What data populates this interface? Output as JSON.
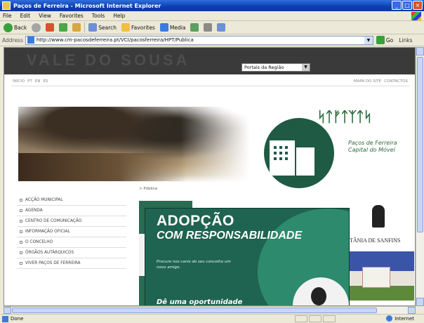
{
  "window": {
    "title": "Paços de Ferreira - Microsoft Internet Explorer",
    "controls": [
      "_",
      "□",
      "×"
    ]
  },
  "menu": [
    "File",
    "Edit",
    "View",
    "Favorites",
    "Tools",
    "Help"
  ],
  "toolbar": {
    "back": "Back",
    "search": "Search",
    "favorites": "Favorites",
    "media": "Media"
  },
  "address": {
    "label": "Address",
    "url": "http://www.cm-pacosdeferreira.pt/VCI/pacosferreira/HPT/Publica",
    "go": "Go",
    "links": "Links"
  },
  "site": {
    "logo": "VALE DO SOUSA",
    "portal_select": "Portais da Região",
    "topnav_left": [
      "INÍCIO",
      "PT",
      "EN",
      "ES"
    ],
    "topnav_right": [
      "MAPA DO SITE",
      "CONTACTOS"
    ],
    "emblem_wordmark": "ᛋᛏᚠᛏᛉᛏᛋ",
    "tagline": [
      "Paços de Ferreira",
      "Capital do Móvel"
    ],
    "breadcrumb": "> Pública",
    "leftnav": [
      "ACÇÃO MUNICIPAL",
      "AGENDA",
      "CENTRO DE COMUNICAÇÃO",
      "INFORMAÇÃO OFICIAL",
      "O CONCELHO",
      "ÓRGÃOS AUTÁRQUICOS",
      "VIVER PAÇOS DE FERREIRA"
    ],
    "sanfins_title": "CITÂNIA DE SANFINS"
  },
  "popup": {
    "title1": "ADOPÇÃO",
    "title2": "COM RESPONSABILIDADE",
    "body": "Procure nos canis do seu concelho um novo amigo.",
    "bottom": "Dê uma oportunidade"
  },
  "status": {
    "text": "Done",
    "zone": "Internet"
  }
}
